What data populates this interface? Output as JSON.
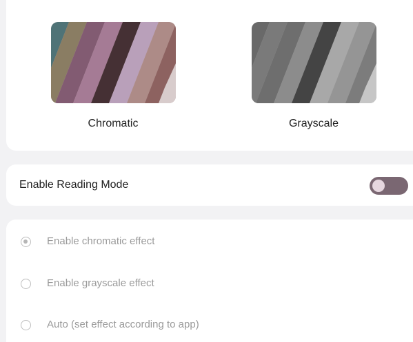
{
  "previews": {
    "chromatic": {
      "label": "Chromatic",
      "icon": "chromatic-preview-thumbnail"
    },
    "grayscale": {
      "label": "Grayscale",
      "icon": "grayscale-preview-thumbnail"
    }
  },
  "reading_mode": {
    "label": "Enable Reading Mode",
    "enabled": false
  },
  "effect_options": [
    {
      "label": "Enable chromatic effect",
      "selected": true
    },
    {
      "label": "Enable grayscale effect",
      "selected": false
    },
    {
      "label": "Auto (set effect according to app)",
      "selected": false
    }
  ],
  "colors": {
    "switch_track": "#7a6772",
    "switch_knob": "#e6d7df",
    "disabled_text": "#9a9a9a",
    "background": "#f2f2f4"
  }
}
